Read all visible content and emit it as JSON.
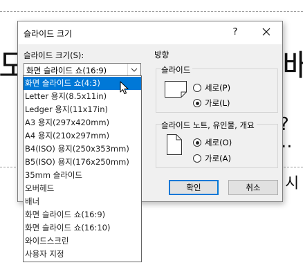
{
  "background": {
    "char_top": "도",
    "char_right": "배",
    "char_mid_right": "?",
    "char_dots": "..",
    "char_right_low": "시"
  },
  "dialog": {
    "title": "슬라이드 크기",
    "help_label": "?",
    "close_label": "✕",
    "size_label": "슬라이드 크기(S):",
    "selected_size": "화면 슬라이드 쇼(16:9)",
    "orientation_label": "방향",
    "slides_group": {
      "label": "슬라이드",
      "options": [
        "세로(P)",
        "가로(L)"
      ],
      "selected": "가로(L)"
    },
    "notes_group": {
      "label": "슬라이드 노트, 유인물, 개요",
      "options": [
        "세로(O)",
        "가로(A)"
      ],
      "selected": "세로(O)"
    },
    "ok_label": "확인",
    "cancel_label": "취소"
  },
  "dropdown": {
    "items": [
      "화면 슬라이드 쇼(4:3)",
      "Letter 용지(8.5x11in)",
      "Ledger 용지(11x17in)",
      "A3 용지(297x420mm)",
      "A4 용지(210x297mm)",
      "B4(ISO) 용지(250x353mm)",
      "B5(ISO) 용지(176x250mm)",
      "35mm 슬라이드",
      "오버헤드",
      "배너",
      "화면 슬라이드 쇼(16:9)",
      "화면 슬라이드 쇼(16:10)",
      "와이드스크린",
      "사용자 지정"
    ],
    "highlighted": "화면 슬라이드 쇼(4:3)"
  },
  "colors": {
    "highlight": "#0078d7",
    "dialog_bg": "#f0f0f0"
  }
}
